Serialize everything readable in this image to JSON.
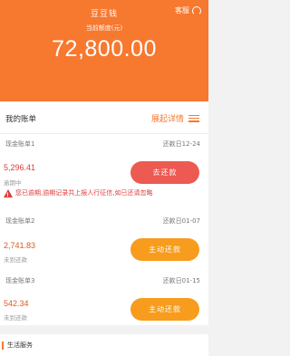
{
  "header": {
    "app_title": "豆豆钱",
    "service_label": "客服",
    "limit_label": "当前额度(元)",
    "amount": "72,800.00"
  },
  "section": {
    "title": "我的账单",
    "expand_label": "展起详情"
  },
  "bills": [
    {
      "name": "现金账单1",
      "due": "还款日12-24",
      "amount": "5,296.41",
      "status": "逾期中",
      "button": "去还款",
      "warning": "您已逾期,逾期记录共上报人行征信,如已还请忽略"
    },
    {
      "name": "现金账单2",
      "due": "还款日01-07",
      "amount": "2,741.83",
      "status": "未到还款",
      "button": "主动还款"
    },
    {
      "name": "现金账单3",
      "due": "还款日01-15",
      "amount": "542.34",
      "status": "未到还款",
      "button": "主动还款"
    }
  ],
  "life": {
    "title": "生活服务"
  },
  "colors": {
    "brand": "#f7782f",
    "overdue": "#ec5a52",
    "pay": "#f79c1d"
  }
}
